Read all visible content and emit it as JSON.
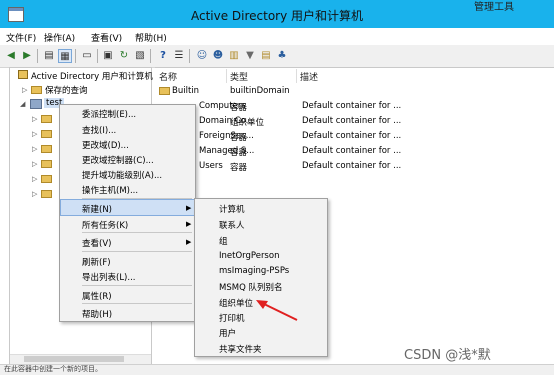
{
  "window": {
    "title": "Active Directory 用户和计算机",
    "top_right_label": "管理工具"
  },
  "menubar": [
    "文件(F)",
    "操作(A)",
    "查看(V)",
    "帮助(H)"
  ],
  "toolbar_icons": [
    "back-icon",
    "forward-icon",
    "up-folder-icon",
    "tree-icon",
    "properties-icon",
    "export-icon",
    "refresh-icon",
    "copy-icon",
    "help-icon",
    "list-icon",
    "add-user-icon",
    "add-group-icon",
    "add-ou-icon",
    "filter-icon",
    "find-icon",
    "group-icon"
  ],
  "tree": {
    "root_label": "Active Directory 用户和计算机",
    "saved_queries": "保存的查询",
    "domain_label": "test"
  },
  "list": {
    "columns": [
      "名称",
      "类型",
      "描述"
    ],
    "rows": [
      {
        "name": "Builtin",
        "type": "builtinDomain",
        "desc": ""
      },
      {
        "name": "Computers",
        "type": "容器",
        "desc": "Default container for ..."
      },
      {
        "name": "Domain Co...",
        "type": "组织单位",
        "desc": "Default container for ..."
      },
      {
        "name": "ForeignSec...",
        "type": "容器",
        "desc": "Default container for ..."
      },
      {
        "name": "Managed S...",
        "type": "容器",
        "desc": "Default container for ..."
      },
      {
        "name": "Users",
        "type": "容器",
        "desc": "Default container for ..."
      }
    ]
  },
  "context_menu": {
    "items": [
      "委派控制(E)...",
      "查找(I)...",
      "更改域(D)...",
      "更改域控制器(C)...",
      "提升域功能级别(A)...",
      "操作主机(M)...",
      "新建(N)",
      "所有任务(K)",
      "查看(V)",
      "刷新(F)",
      "导出列表(L)...",
      "属性(R)",
      "帮助(H)"
    ],
    "highlighted": "新建(N)"
  },
  "submenu": {
    "items": [
      "计算机",
      "联系人",
      "组",
      "InetOrgPerson",
      "msImaging-PSPs",
      "MSMQ 队列别名",
      "组织单位",
      "打印机",
      "用户",
      "共享文件夹"
    ]
  },
  "status": "在此容器中创建一个新的项目。",
  "watermark": "CSDN @浅*默",
  "colors": {
    "titlebar": "#19b2ec",
    "highlight": "#cfe0f5",
    "annotation_arrow": "#e02020"
  }
}
